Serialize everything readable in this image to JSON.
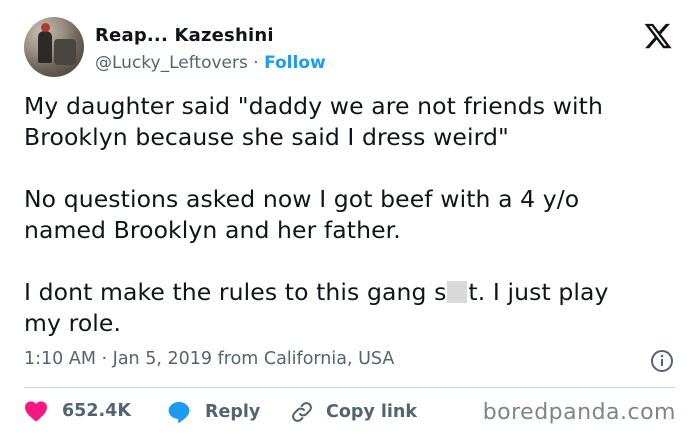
{
  "author": {
    "display_name": "Reap... Kazeshini",
    "handle": "@Lucky_Leftovers",
    "separator": "·",
    "follow_label": "Follow"
  },
  "tweet": {
    "paragraphs": [
      [
        "My daughter said \"daddy we are not friends with",
        "Brooklyn because she said I dress weird\""
      ],
      [
        "No questions asked now I got beef with a 4 y/o",
        "named Brooklyn and her father."
      ]
    ],
    "last_line_1_before": "I dont make the rules to this gang s",
    "last_line_1_after": "t. I just play",
    "last_line_2": "my role."
  },
  "meta": {
    "time": "1:10 AM",
    "separator": "·",
    "date": "Jan 5, 2019",
    "location_text": "from California, USA"
  },
  "actions": {
    "like_count": "652.4K",
    "reply_label": "Reply",
    "copy_label": "Copy link"
  },
  "watermark": "boredpanda.com",
  "colors": {
    "text": "#0f1419",
    "secondary": "#536471",
    "accent": "#1d9bf0",
    "like": "#f91880",
    "divider": "#cfd9de"
  },
  "icons": {
    "logo": "x-logo-icon",
    "info": "info-icon",
    "like": "heart-icon",
    "reply": "speech-bubble-icon",
    "copy": "link-icon"
  }
}
